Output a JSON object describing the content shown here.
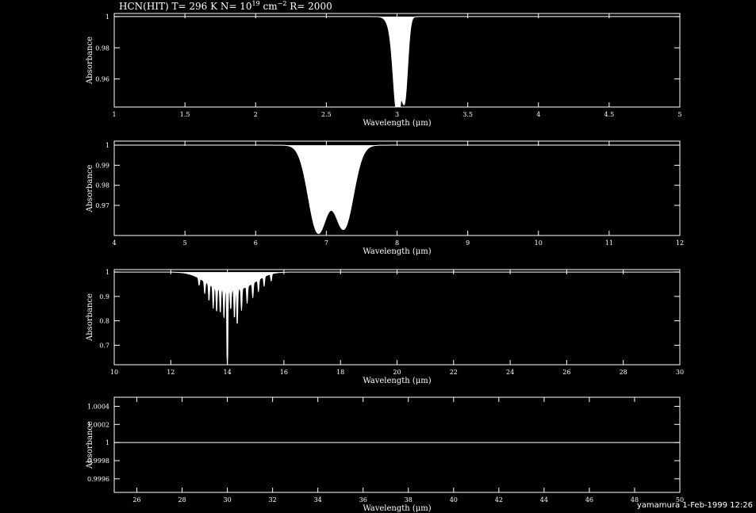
{
  "title": {
    "prefix": "HCN(HIT) T= 296 K N= 10",
    "exponent1": "19",
    "middle": " cm",
    "exponent2": "−2",
    "suffix": " R= 2000"
  },
  "footer": "yamamura 1-Feb-1999 12:26",
  "colors": {
    "background": "#000000",
    "foreground": "#ffffff"
  },
  "chart_data": [
    {
      "type": "area",
      "xlabel": "Wavelength (μm)",
      "ylabel": "Absorbance",
      "xlim": [
        1,
        5
      ],
      "ylim": [
        0.942,
        1.002
      ],
      "xticks": [
        "1",
        "1.5",
        "2",
        "2.5",
        "3",
        "3.5",
        "4",
        "4.5",
        "5"
      ],
      "yticks": [
        {
          "v": 1,
          "t": "1"
        },
        {
          "v": 0.98,
          "t": "0.98"
        },
        {
          "v": 0.96,
          "t": "0.96"
        }
      ],
      "bands": [
        {
          "center": 3.0,
          "width": 0.035,
          "depth": 0.053
        },
        {
          "center": 3.055,
          "width": 0.03,
          "depth": 0.05
        },
        {
          "center": 2.975,
          "width": 0.05,
          "depth": 0.01
        }
      ],
      "spikes": [
        {
          "x": 3.02,
          "depth": 0.006
        }
      ]
    },
    {
      "type": "area",
      "xlabel": "Wavelength (μm)",
      "ylabel": "Absorbance",
      "xlim": [
        4,
        12
      ],
      "ylim": [
        0.955,
        1.002
      ],
      "xticks": [
        "4",
        "5",
        "6",
        "7",
        "8",
        "9",
        "10",
        "11",
        "12"
      ],
      "yticks": [
        {
          "v": 1,
          "t": "1"
        },
        {
          "v": 0.99,
          "t": "0.99"
        },
        {
          "v": 0.98,
          "t": "0.98"
        },
        {
          "v": 0.97,
          "t": "0.97"
        }
      ],
      "bands": [
        {
          "center": 6.88,
          "width": 0.19,
          "depth": 0.043
        },
        {
          "center": 7.25,
          "width": 0.19,
          "depth": 0.041
        }
      ],
      "spikes": []
    },
    {
      "type": "area",
      "xlabel": "Wavelength (μm)",
      "ylabel": "Absorbance",
      "xlim": [
        10,
        30
      ],
      "ylim": [
        0.62,
        1.01
      ],
      "xticks": [
        "10",
        "12",
        "14",
        "16",
        "18",
        "20",
        "22",
        "24",
        "26",
        "28",
        "30"
      ],
      "yticks": [
        {
          "v": 1,
          "t": "1"
        },
        {
          "v": 0.9,
          "t": "0.9"
        },
        {
          "v": 0.8,
          "t": "0.8"
        },
        {
          "v": 0.7,
          "t": "0.7"
        }
      ],
      "bands": [
        {
          "center": 13.7,
          "width": 0.75,
          "depth": 0.06
        },
        {
          "center": 14.6,
          "width": 0.7,
          "depth": 0.05
        }
      ],
      "spikes": [
        {
          "x": 13.0,
          "depth": 0.03
        },
        {
          "x": 13.2,
          "depth": 0.05
        },
        {
          "x": 13.35,
          "depth": 0.07
        },
        {
          "x": 13.5,
          "depth": 0.09
        },
        {
          "x": 13.62,
          "depth": 0.1
        },
        {
          "x": 13.75,
          "depth": 0.1
        },
        {
          "x": 13.88,
          "depth": 0.12
        },
        {
          "x": 14.0,
          "depth": 0.38
        },
        {
          "x": 14.12,
          "depth": 0.08
        },
        {
          "x": 14.25,
          "depth": 0.12
        },
        {
          "x": 14.35,
          "depth": 0.15
        },
        {
          "x": 14.5,
          "depth": 0.09
        },
        {
          "x": 14.7,
          "depth": 0.07
        },
        {
          "x": 14.9,
          "depth": 0.06
        },
        {
          "x": 15.1,
          "depth": 0.05
        },
        {
          "x": 15.3,
          "depth": 0.04
        },
        {
          "x": 15.55,
          "depth": 0.03
        }
      ]
    },
    {
      "type": "line",
      "xlabel": "Wavelength (μm)",
      "ylabel": "Absorbance",
      "xlim": [
        25,
        50
      ],
      "ylim": [
        0.99945,
        1.0005
      ],
      "xticks": [
        "26",
        "28",
        "30",
        "32",
        "34",
        "36",
        "38",
        "40",
        "42",
        "44",
        "46",
        "48",
        "50"
      ],
      "yticks": [
        {
          "v": 1.0004,
          "t": "1.0004"
        },
        {
          "v": 1.0002,
          "t": "1.0002"
        },
        {
          "v": 1,
          "t": "1"
        },
        {
          "v": 0.9998,
          "t": "0.9998"
        },
        {
          "v": 0.9996,
          "t": "0.9996"
        }
      ],
      "bands": [],
      "spikes": []
    }
  ]
}
